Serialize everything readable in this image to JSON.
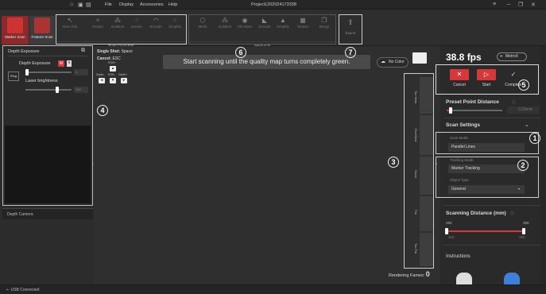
{
  "window": {
    "title": "Project1202024173338"
  },
  "menu": {
    "file": "File",
    "display": "Display",
    "accessories": "Accessories",
    "help": "Help"
  },
  "modes": {
    "marker_scan": "Marker Scan",
    "feature_scan": "Feature Scan"
  },
  "toolbar": {
    "tools": [
      "One-click",
      "Fusion",
      "Isolation",
      "Overla-",
      "Smooth",
      "Simplify",
      "Mesh",
      "Isolation",
      "Fill Holes",
      "Smooth",
      "Simplify",
      "Texture",
      "Merge"
    ],
    "point_cloud_group": "Point Cloud Edit",
    "mesh_group": "Mesh Edit",
    "export": "Export"
  },
  "left_panel": {
    "title": "Depth Exposure",
    "depth_exposure": "Depth Exposure",
    "m_badge": "M",
    "ring_label": "Ring",
    "depth_value": "4",
    "laser_brightness": "Laser brightness",
    "laser_value": "100",
    "depth_camera": "Depth Camera"
  },
  "shortcuts": {
    "single_shot": "Single Shot:",
    "space": "Space",
    "cancel": "Cancel:",
    "esc": "ESC",
    "depth_plus": "Depth+",
    "depth_minus": "Depth-",
    "rgb_minus": "RGB-",
    "rgb_plus": "RGB+"
  },
  "banner": "Start scanning until the quality map turns completely green.",
  "no_color": "No Color",
  "quality": {
    "labels": [
      "Too Near",
      "Excellent",
      "Good",
      "Far",
      "Too Far"
    ],
    "rendering_frames": "Rendering Fames:",
    "frames_value": "0"
  },
  "right_panel": {
    "fps": "38.8 fps",
    "metrox": "MetroX",
    "cancel": "Cancel",
    "start": "Start",
    "complete": "Complete",
    "preset_point_distance": "Preset Point Distance",
    "ppd_value": "0.20mm",
    "scan_settings": "Scan Settings",
    "scan_mode_label": "Scan Mode",
    "scan_mode_value": "Parallel Lines",
    "tracking_mode_label": "Tracking Mode",
    "tracking_mode_value": "Marker Tracking",
    "object_type_label": "Object Type",
    "object_type_value": "General",
    "scanning_distance": "Scanning Distance (mm)",
    "dist_min": "250",
    "dist_max": "350",
    "dist_min2": "250",
    "dist_max2": "350",
    "instructions": "Instructions"
  },
  "annotations": [
    "1",
    "2",
    "3",
    "4",
    "5",
    "6",
    "7"
  ],
  "status": {
    "usb": "USB Connected"
  },
  "colors": {
    "accent": "#d6383a",
    "panel": "#2a2a2a"
  }
}
